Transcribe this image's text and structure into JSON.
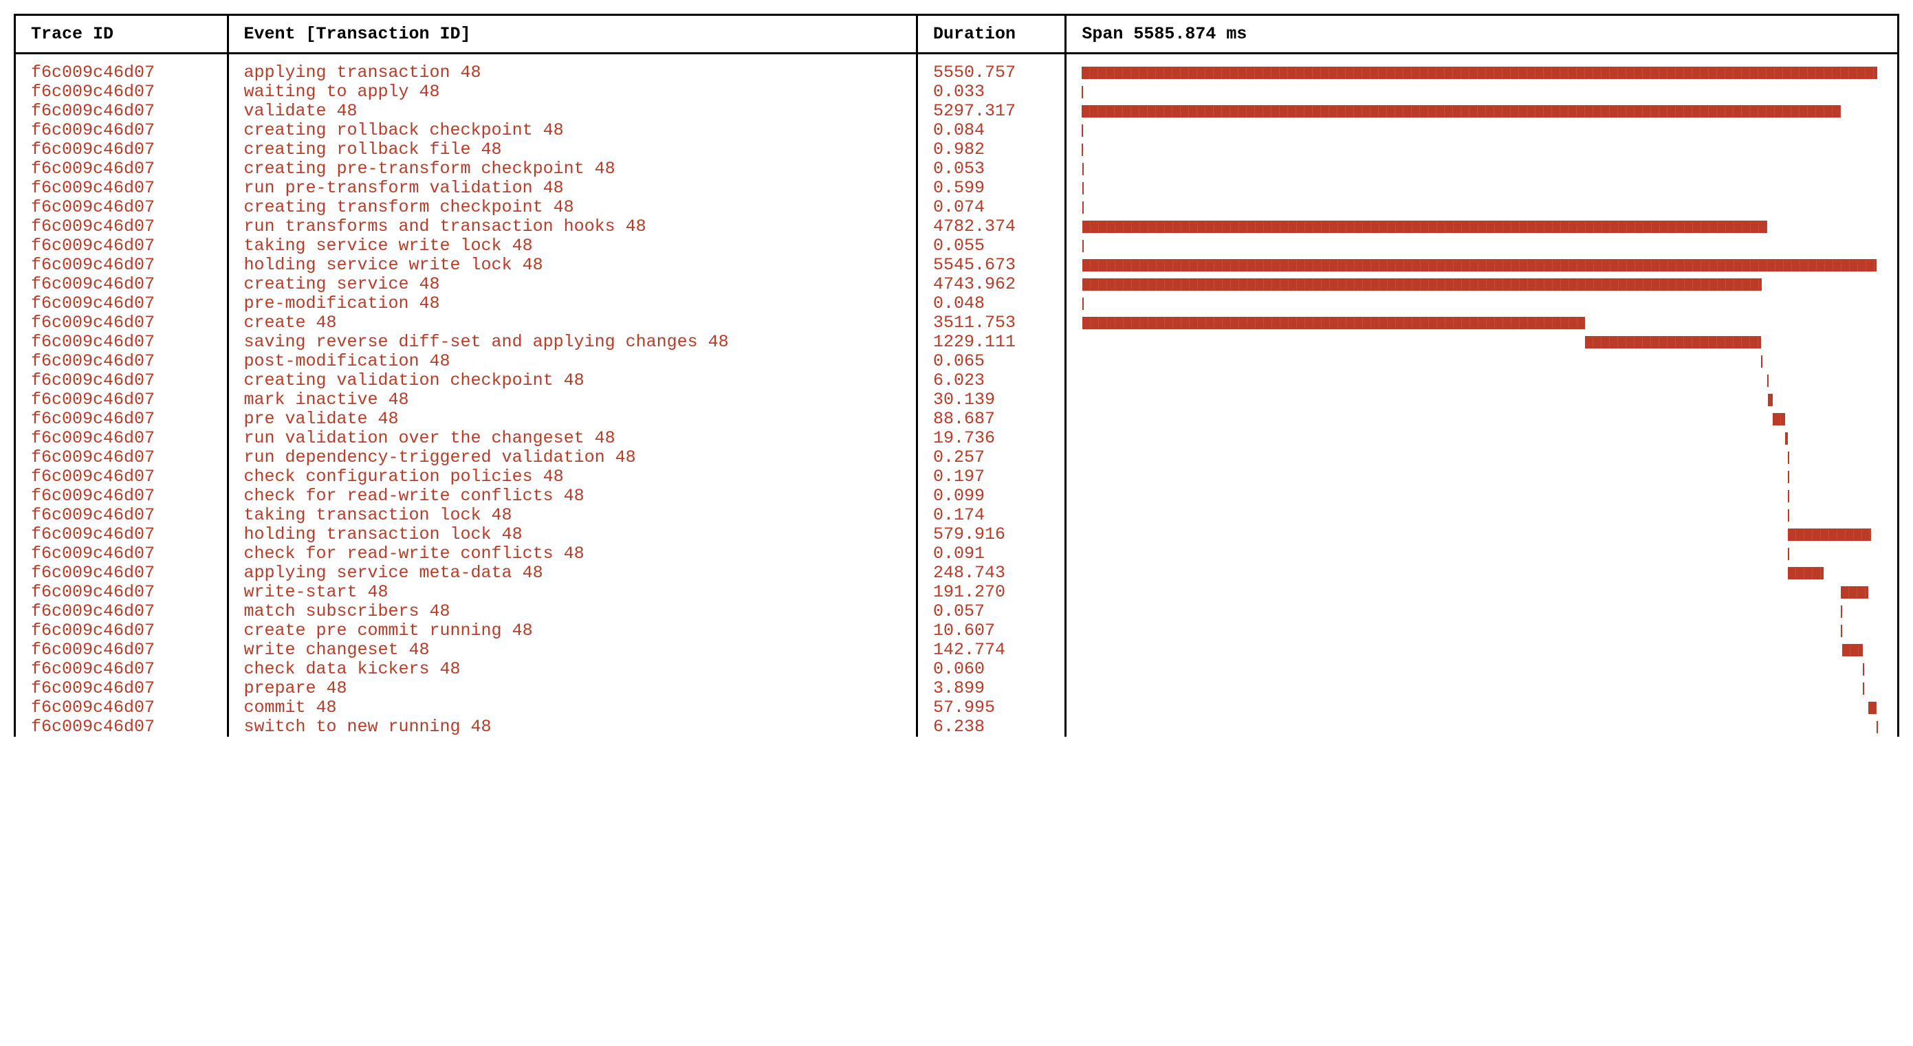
{
  "colors": {
    "accent": "#bc3b27"
  },
  "header": {
    "trace_id": "Trace ID",
    "event": "Event [Transaction ID]",
    "duration": "Duration",
    "span": "Span 5585.874 ms"
  },
  "span_total_ms": 5585.874,
  "rows": [
    {
      "trace_id": "f6c009c46d07",
      "event": "applying transaction 48",
      "duration": "5550.757",
      "start_ms": 0.0,
      "dur_ms": 5550.757
    },
    {
      "trace_id": "f6c009c46d07",
      "event": "waiting to apply 48",
      "duration": "0.033",
      "start_ms": 0.0,
      "dur_ms": 0.033
    },
    {
      "trace_id": "f6c009c46d07",
      "event": "validate 48",
      "duration": "5297.317",
      "start_ms": 0.033,
      "dur_ms": 5297.317
    },
    {
      "trace_id": "f6c009c46d07",
      "event": "creating rollback checkpoint 48",
      "duration": "0.084",
      "start_ms": 0.033,
      "dur_ms": 0.084
    },
    {
      "trace_id": "f6c009c46d07",
      "event": "creating rollback file 48",
      "duration": "0.982",
      "start_ms": 0.117,
      "dur_ms": 0.982
    },
    {
      "trace_id": "f6c009c46d07",
      "event": "creating pre-transform checkpoint 48",
      "duration": "0.053",
      "start_ms": 1.099,
      "dur_ms": 0.053
    },
    {
      "trace_id": "f6c009c46d07",
      "event": "run pre-transform validation 48",
      "duration": "0.599",
      "start_ms": 1.152,
      "dur_ms": 0.599
    },
    {
      "trace_id": "f6c009c46d07",
      "event": "creating transform checkpoint 48",
      "duration": "0.074",
      "start_ms": 1.751,
      "dur_ms": 0.074
    },
    {
      "trace_id": "f6c009c46d07",
      "event": "run transforms and transaction hooks 48",
      "duration": "4782.374",
      "start_ms": 1.825,
      "dur_ms": 4782.374
    },
    {
      "trace_id": "f6c009c46d07",
      "event": "taking service write lock 48",
      "duration": "0.055",
      "start_ms": 1.825,
      "dur_ms": 0.055
    },
    {
      "trace_id": "f6c009c46d07",
      "event": "holding service write lock 48",
      "duration": "5545.673",
      "start_ms": 1.88,
      "dur_ms": 5545.673
    },
    {
      "trace_id": "f6c009c46d07",
      "event": "creating service 48",
      "duration": "4743.962",
      "start_ms": 1.88,
      "dur_ms": 4743.962
    },
    {
      "trace_id": "f6c009c46d07",
      "event": "pre-modification 48",
      "duration": "0.048",
      "start_ms": 1.88,
      "dur_ms": 0.048
    },
    {
      "trace_id": "f6c009c46d07",
      "event": "create 48",
      "duration": "3511.753",
      "start_ms": 1.928,
      "dur_ms": 3511.753
    },
    {
      "trace_id": "f6c009c46d07",
      "event": "saving reverse diff-set and applying changes 48",
      "duration": "1229.111",
      "start_ms": 3513.681,
      "dur_ms": 1229.111
    },
    {
      "trace_id": "f6c009c46d07",
      "event": "post-modification 48",
      "duration": "0.065",
      "start_ms": 4742.792,
      "dur_ms": 0.065
    },
    {
      "trace_id": "f6c009c46d07",
      "event": "creating validation checkpoint 48",
      "duration": "6.023",
      "start_ms": 4784.199,
      "dur_ms": 6.023
    },
    {
      "trace_id": "f6c009c46d07",
      "event": "mark inactive 48",
      "duration": "30.139",
      "start_ms": 4790.222,
      "dur_ms": 30.139
    },
    {
      "trace_id": "f6c009c46d07",
      "event": "pre validate 48",
      "duration": "88.687",
      "start_ms": 4820.361,
      "dur_ms": 88.687
    },
    {
      "trace_id": "f6c009c46d07",
      "event": "run validation over the changeset 48",
      "duration": "19.736",
      "start_ms": 4909.048,
      "dur_ms": 19.736
    },
    {
      "trace_id": "f6c009c46d07",
      "event": "run dependency-triggered validation 48",
      "duration": "0.257",
      "start_ms": 4928.784,
      "dur_ms": 0.257
    },
    {
      "trace_id": "f6c009c46d07",
      "event": "check configuration policies 48",
      "duration": "0.197",
      "start_ms": 4929.041,
      "dur_ms": 0.197
    },
    {
      "trace_id": "f6c009c46d07",
      "event": "check for read-write conflicts 48",
      "duration": "0.099",
      "start_ms": 4929.238,
      "dur_ms": 0.099
    },
    {
      "trace_id": "f6c009c46d07",
      "event": "taking transaction lock 48",
      "duration": "0.174",
      "start_ms": 4929.337,
      "dur_ms": 0.174
    },
    {
      "trace_id": "f6c009c46d07",
      "event": "holding transaction lock 48",
      "duration": "579.916",
      "start_ms": 4929.511,
      "dur_ms": 579.916
    },
    {
      "trace_id": "f6c009c46d07",
      "event": "check for read-write conflicts 48",
      "duration": "0.091",
      "start_ms": 4929.511,
      "dur_ms": 0.091
    },
    {
      "trace_id": "f6c009c46d07",
      "event": "applying service meta-data 48",
      "duration": "248.743",
      "start_ms": 4929.602,
      "dur_ms": 248.743
    },
    {
      "trace_id": "f6c009c46d07",
      "event": "write-start 48",
      "duration": "191.270",
      "start_ms": 5297.35,
      "dur_ms": 191.27
    },
    {
      "trace_id": "f6c009c46d07",
      "event": "match subscribers 48",
      "duration": "0.057",
      "start_ms": 5297.35,
      "dur_ms": 0.057
    },
    {
      "trace_id": "f6c009c46d07",
      "event": "create pre commit running 48",
      "duration": "10.607",
      "start_ms": 5297.407,
      "dur_ms": 10.607
    },
    {
      "trace_id": "f6c009c46d07",
      "event": "write changeset 48",
      "duration": "142.774",
      "start_ms": 5308.014,
      "dur_ms": 142.774
    },
    {
      "trace_id": "f6c009c46d07",
      "event": "check data kickers 48",
      "duration": "0.060",
      "start_ms": 5450.788,
      "dur_ms": 0.06
    },
    {
      "trace_id": "f6c009c46d07",
      "event": "prepare 48",
      "duration": "3.899",
      "start_ms": 5450.848,
      "dur_ms": 3.899
    },
    {
      "trace_id": "f6c009c46d07",
      "event": "commit 48",
      "duration": "57.995",
      "start_ms": 5488.62,
      "dur_ms": 57.995
    },
    {
      "trace_id": "f6c009c46d07",
      "event": "switch to new running 48",
      "duration": "6.238",
      "start_ms": 5546.615,
      "dur_ms": 6.238
    }
  ]
}
